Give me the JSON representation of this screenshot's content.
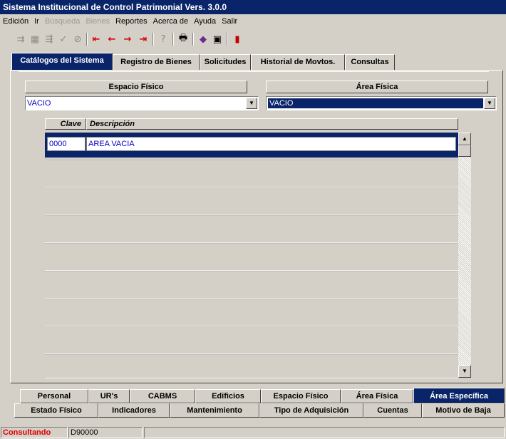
{
  "window": {
    "title": "Sistema Institucional de Control Patrimonial Vers. 3.0.0"
  },
  "menu": {
    "items": [
      {
        "label": "Edición",
        "enabled": true
      },
      {
        "label": "Ir",
        "enabled": true
      },
      {
        "label": "Búsqueda",
        "enabled": false
      },
      {
        "label": "Bienes",
        "enabled": false
      },
      {
        "label": "Reportes",
        "enabled": true
      },
      {
        "label": "Acerca de",
        "enabled": true
      },
      {
        "label": "Ayuda",
        "enabled": true
      },
      {
        "label": "Salir",
        "enabled": true
      }
    ]
  },
  "toolbar": {
    "icons": [
      "insert-record-icon",
      "duplicate-record-icon",
      "delete-record-icon",
      "accept-icon",
      "cancel-icon",
      "first-record-icon",
      "previous-record-icon",
      "next-record-icon",
      "last-record-icon",
      "query-icon",
      "print-icon",
      "eraser-icon",
      "save-icon",
      "exit-door-icon"
    ]
  },
  "top_tabs": [
    {
      "label": "Catálogos del Sistema",
      "active": true
    },
    {
      "label": "Registro de Bienes",
      "active": false
    },
    {
      "label": "Solicitudes",
      "active": false
    },
    {
      "label": "Historial de Movtos.",
      "active": false
    },
    {
      "label": "Consultas",
      "active": false
    }
  ],
  "filters": {
    "espacio": {
      "label": "Espacio Físico",
      "value": "VACIO"
    },
    "area": {
      "label": "Área Física",
      "value": "VACIO"
    }
  },
  "grid": {
    "columns": [
      "Clave",
      "Descripción"
    ],
    "rows": [
      {
        "clave": "0000",
        "descripcion": "AREA VACIA"
      }
    ]
  },
  "bottom_tabs": {
    "row1": [
      {
        "label": "Personal",
        "active": false
      },
      {
        "label": "UR's",
        "active": false
      },
      {
        "label": "CABMS",
        "active": false
      },
      {
        "label": "Edificios",
        "active": false
      },
      {
        "label": "Espacio Físico",
        "active": false
      },
      {
        "label": "Área Física",
        "active": false
      },
      {
        "label": "Área Específica",
        "active": true
      }
    ],
    "row2": [
      {
        "label": "Estado Físico",
        "active": false
      },
      {
        "label": "Indicadores",
        "active": false
      },
      {
        "label": "Mantenimiento",
        "active": false
      },
      {
        "label": "Tipo de Adquisición",
        "active": false
      },
      {
        "label": "Cuentas",
        "active": false
      },
      {
        "label": "Motivo de Baja",
        "active": false
      }
    ]
  },
  "status": {
    "mode": "Consultando",
    "code": "D90000",
    "mode_color": "#e00000"
  }
}
